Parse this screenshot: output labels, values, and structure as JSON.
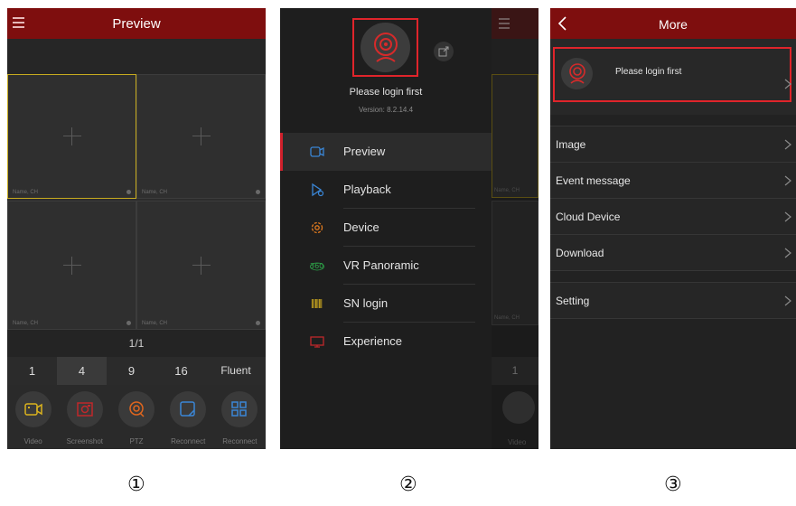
{
  "panel1": {
    "title": "Preview",
    "cells": [
      {
        "caption": "Name, CH"
      },
      {
        "caption": "Name, CH"
      },
      {
        "caption": "Name, CH"
      },
      {
        "caption": "Name, CH"
      }
    ],
    "pager": "1/1",
    "splits": [
      "1",
      "4",
      "9",
      "16",
      "Fluent"
    ],
    "selected_split": "4",
    "tools": [
      {
        "label": "Video",
        "icon": "video-icon"
      },
      {
        "label": "Screenshot",
        "icon": "screenshot-icon"
      },
      {
        "label": "PTZ",
        "icon": "ptz-icon"
      },
      {
        "label": "Reconnect",
        "icon": "reconnect-icon"
      },
      {
        "label": "Reconnect",
        "icon": "grid-icon"
      }
    ],
    "colors": {
      "header": "#7e0e0e",
      "selected_cell_border": "#c7ab1f"
    }
  },
  "panel2": {
    "login_text": "Please login first",
    "version": "Version: 8.2.14.4",
    "menu": [
      {
        "label": "Preview",
        "icon": "camera-icon",
        "active": true
      },
      {
        "label": "Playback",
        "icon": "playback-icon"
      },
      {
        "label": "Device",
        "icon": "device-gear-icon"
      },
      {
        "label": "VR Panoramic",
        "icon": "vr-360-icon"
      },
      {
        "label": "SN login",
        "icon": "barcode-icon"
      },
      {
        "label": "Experience",
        "icon": "monitor-icon"
      }
    ],
    "behind": {
      "cell_caption_top": "Name, CH",
      "cell_caption_bottom": "Name, CH",
      "split": "1",
      "tool_label": "Video"
    },
    "colors": {
      "highlight": "#e0242b"
    }
  },
  "panel3": {
    "title": "More",
    "login_text": "Please login first",
    "items": [
      "Image",
      "Event message",
      "Cloud Device",
      "Download"
    ],
    "setting": "Setting"
  },
  "captions": [
    "①",
    "②",
    "③"
  ]
}
